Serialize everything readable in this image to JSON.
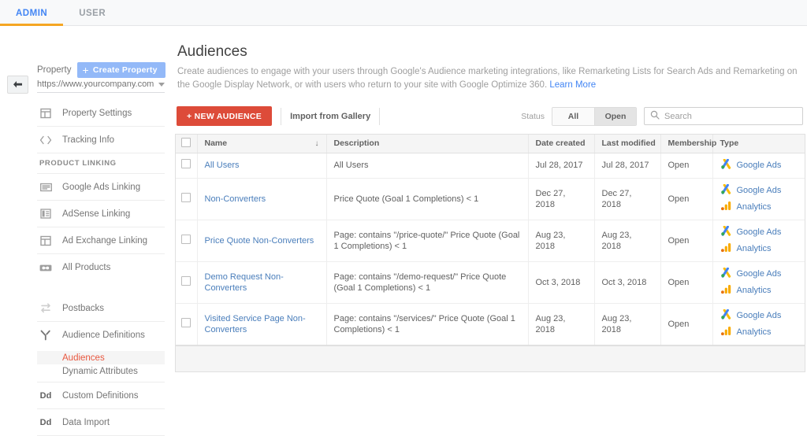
{
  "topbar": {
    "tabs": [
      {
        "label": "ADMIN",
        "active": true
      },
      {
        "label": "USER",
        "active": false
      }
    ]
  },
  "sidebar": {
    "back_icon": "back-arrow-icon",
    "property_label": "Property",
    "create_property_label": "Create Property",
    "property_value": "https://www.yourcompany.com",
    "items_top": [
      {
        "label": "Property Settings",
        "icon": "property-settings-icon"
      },
      {
        "label": "Tracking Info",
        "icon": "code-brackets-icon"
      }
    ],
    "section_label": "PRODUCT LINKING",
    "items_linking": [
      {
        "label": "Google Ads Linking",
        "icon": "google-ads-linking-icon"
      },
      {
        "label": "AdSense Linking",
        "icon": "adsense-linking-icon"
      },
      {
        "label": "Ad Exchange Linking",
        "icon": "ad-exchange-linking-icon"
      },
      {
        "label": "All Products",
        "icon": "all-products-icon"
      }
    ],
    "items_bottom": [
      {
        "label": "Postbacks",
        "icon": "postbacks-icon"
      },
      {
        "label": "Audience Definitions",
        "icon": "audience-definitions-icon"
      }
    ],
    "sub_items": [
      {
        "label": "Audiences",
        "selected": true
      },
      {
        "label": "Dynamic Attributes",
        "selected": false
      }
    ],
    "items_tail": [
      {
        "label": "Custom Definitions",
        "icon": "custom-definitions-icon"
      },
      {
        "label": "Data Import",
        "icon": "data-import-icon"
      }
    ]
  },
  "main": {
    "title": "Audiences",
    "description": "Create audiences to engage with your users through Google's Audience marketing integrations, like Remarketing Lists for Search Ads and Remarketing on the Google Display Network, or with users who return to your site with Google Optimize 360.",
    "learn_more": "Learn More",
    "toolbar": {
      "new_audience_label": "+ NEW AUDIENCE",
      "import_label": "Import from Gallery",
      "status_label": "Status",
      "status_all": "All",
      "status_open": "Open",
      "search_placeholder": "Search",
      "search_value": "",
      "search_icon": "search-icon"
    },
    "table": {
      "columns": [
        "Name",
        "Description",
        "Date created",
        "Last modified",
        "Membership",
        "Type"
      ],
      "sort_indicator": "↓",
      "rows": [
        {
          "name": "All Users",
          "description": "All Users",
          "date_created": "Jul 28, 2017",
          "last_modified": "Jul 28, 2017",
          "membership": "Open",
          "types": [
            "Google Ads"
          ]
        },
        {
          "name": "Non-Converters",
          "description": "Price Quote (Goal 1 Completions) < 1",
          "date_created": "Dec 27, 2018",
          "last_modified": "Dec 27, 2018",
          "membership": "Open",
          "types": [
            "Google Ads",
            "Analytics"
          ]
        },
        {
          "name": "Price Quote Non-Converters",
          "description": "Page: contains \"/price-quote/\" Price Quote (Goal 1 Completions) < 1",
          "date_created": "Aug 23, 2018",
          "last_modified": "Aug 23, 2018",
          "membership": "Open",
          "types": [
            "Google Ads",
            "Analytics"
          ]
        },
        {
          "name": "Demo Request Non-Converters",
          "description": "Page: contains \"/demo-request/\" Price Quote (Goal 1 Completions) < 1",
          "date_created": "Oct 3, 2018",
          "last_modified": "Oct 3, 2018",
          "membership": "Open",
          "types": [
            "Google Ads",
            "Analytics"
          ]
        },
        {
          "name": "Visited Service Page Non-Converters",
          "description": "Page: contains \"/services/\" Price Quote (Goal 1 Completions) < 1",
          "date_created": "Aug 23, 2018",
          "last_modified": "Aug 23, 2018",
          "membership": "Open",
          "types": [
            "Google Ads",
            "Analytics"
          ]
        }
      ]
    }
  },
  "colors": {
    "accent_blue": "#4285f4",
    "tab_underline": "#f5a623",
    "primary_button": "#dd4b39",
    "link": "#4a7ebb",
    "selected_nav": "#e8573f"
  }
}
